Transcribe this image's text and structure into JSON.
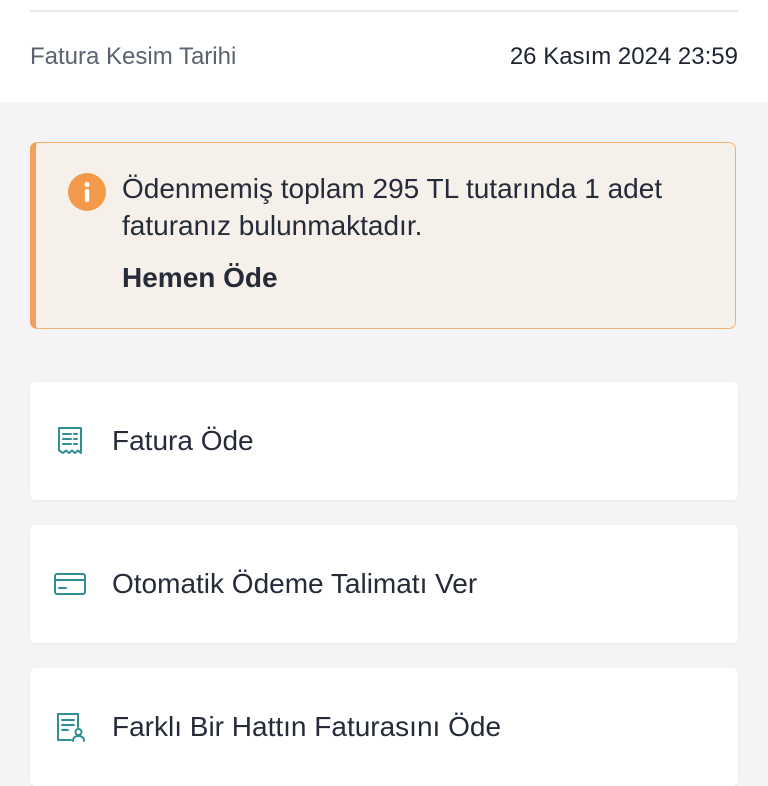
{
  "invoice_info": {
    "label": "Fatura Kesim Tarihi",
    "value": "26 Kasım 2024 23:59"
  },
  "alert": {
    "icon": "info-icon",
    "message": "Ödenmemiş toplam 295 TL tutarında 1 adet faturanız bulunmaktadır.",
    "action_label": "Hemen Öde",
    "colors": {
      "background": "#f6f0ea",
      "border": "#f2a05a",
      "icon": "#f29a4a"
    }
  },
  "menu": {
    "accent_color": "#2f8f94",
    "items": [
      {
        "label": "Fatura Öde",
        "icon": "receipt-icon"
      },
      {
        "label": "Otomatik Ödeme Talimatı Ver",
        "icon": "credit-card-icon"
      },
      {
        "label": "Farklı Bir Hattın Faturasını Öde",
        "icon": "user-document-icon"
      }
    ]
  }
}
